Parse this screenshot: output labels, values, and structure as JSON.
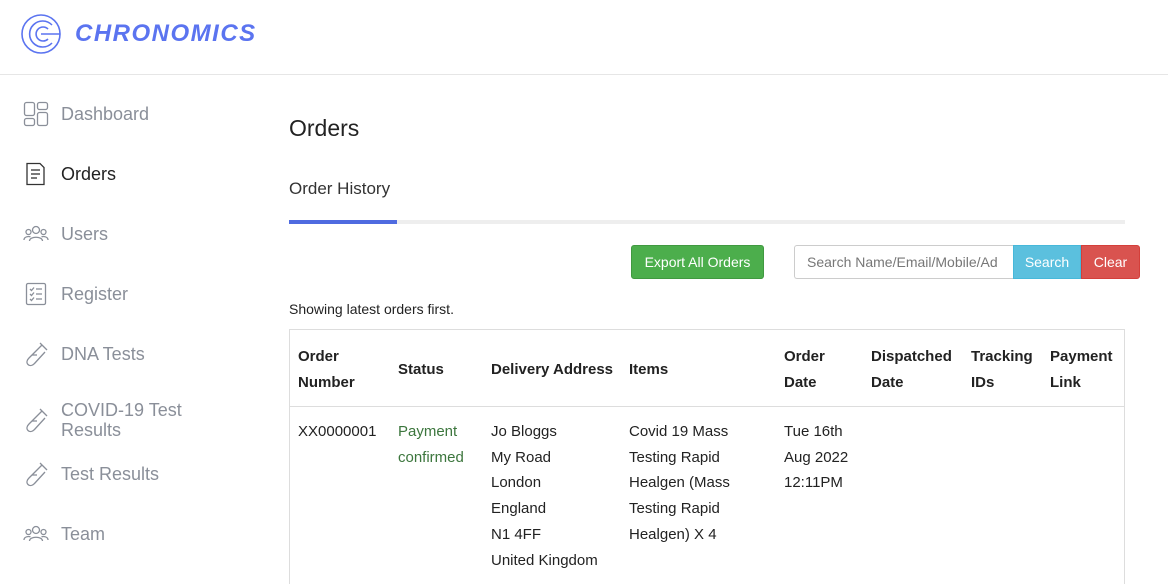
{
  "brand": {
    "name": "CHRONOMICS",
    "color": "#5b74f0"
  },
  "sidebar": {
    "items": [
      {
        "label": "Dashboard",
        "icon": "dashboard-icon",
        "active": false
      },
      {
        "label": "Orders",
        "icon": "orders-icon",
        "active": true
      },
      {
        "label": "Users",
        "icon": "users-icon",
        "active": false
      },
      {
        "label": "Register",
        "icon": "register-icon",
        "active": false
      },
      {
        "label": "DNA Tests",
        "icon": "test-tube-icon",
        "active": false
      },
      {
        "label": "COVID-19 Test Results",
        "label_line1": "COVID-19 Test",
        "label_line2": "Results",
        "icon": "test-tube-icon",
        "active": false
      },
      {
        "label": "Test Results",
        "icon": "test-tube-icon",
        "active": false
      },
      {
        "label": "Team",
        "icon": "team-icon",
        "active": false
      }
    ]
  },
  "main": {
    "title": "Orders",
    "tab": {
      "label": "Order History",
      "accent": "#4f6be0"
    },
    "toolbar": {
      "export_label": "Export All Orders",
      "search_placeholder": "Search Name/Email/Mobile/Ad",
      "search_value": "",
      "search_label": "Search",
      "clear_label": "Clear"
    },
    "note": "Showing latest orders first.",
    "table": {
      "columns": [
        {
          "line1": "Order",
          "line2": "Number"
        },
        {
          "line1": "Status",
          "line2": ""
        },
        {
          "line1": "Delivery Address",
          "line2": ""
        },
        {
          "line1": "Items",
          "line2": ""
        },
        {
          "line1": "Order",
          "line2": "Date"
        },
        {
          "line1": "Dispatched",
          "line2": "Date"
        },
        {
          "line1": "Tracking",
          "line2": "IDs"
        },
        {
          "line1": "Payment",
          "line2": "Link"
        }
      ],
      "rows": [
        {
          "order_number": "XX0000001",
          "status": [
            "Payment",
            "confirmed"
          ],
          "status_color": "#3c763d",
          "address": [
            "Jo Bloggs",
            "My Road",
            "London",
            "England",
            "N1 4FF",
            "United Kingdom"
          ],
          "items": [
            "Covid 19 Mass",
            "Testing Rapid",
            "Healgen (Mass",
            "Testing Rapid",
            "Healgen) X 4"
          ],
          "order_date": [
            "Tue 16th",
            "Aug 2022",
            "12:11PM"
          ],
          "dispatched_date": "",
          "tracking_ids": "",
          "payment_link": ""
        }
      ]
    }
  }
}
